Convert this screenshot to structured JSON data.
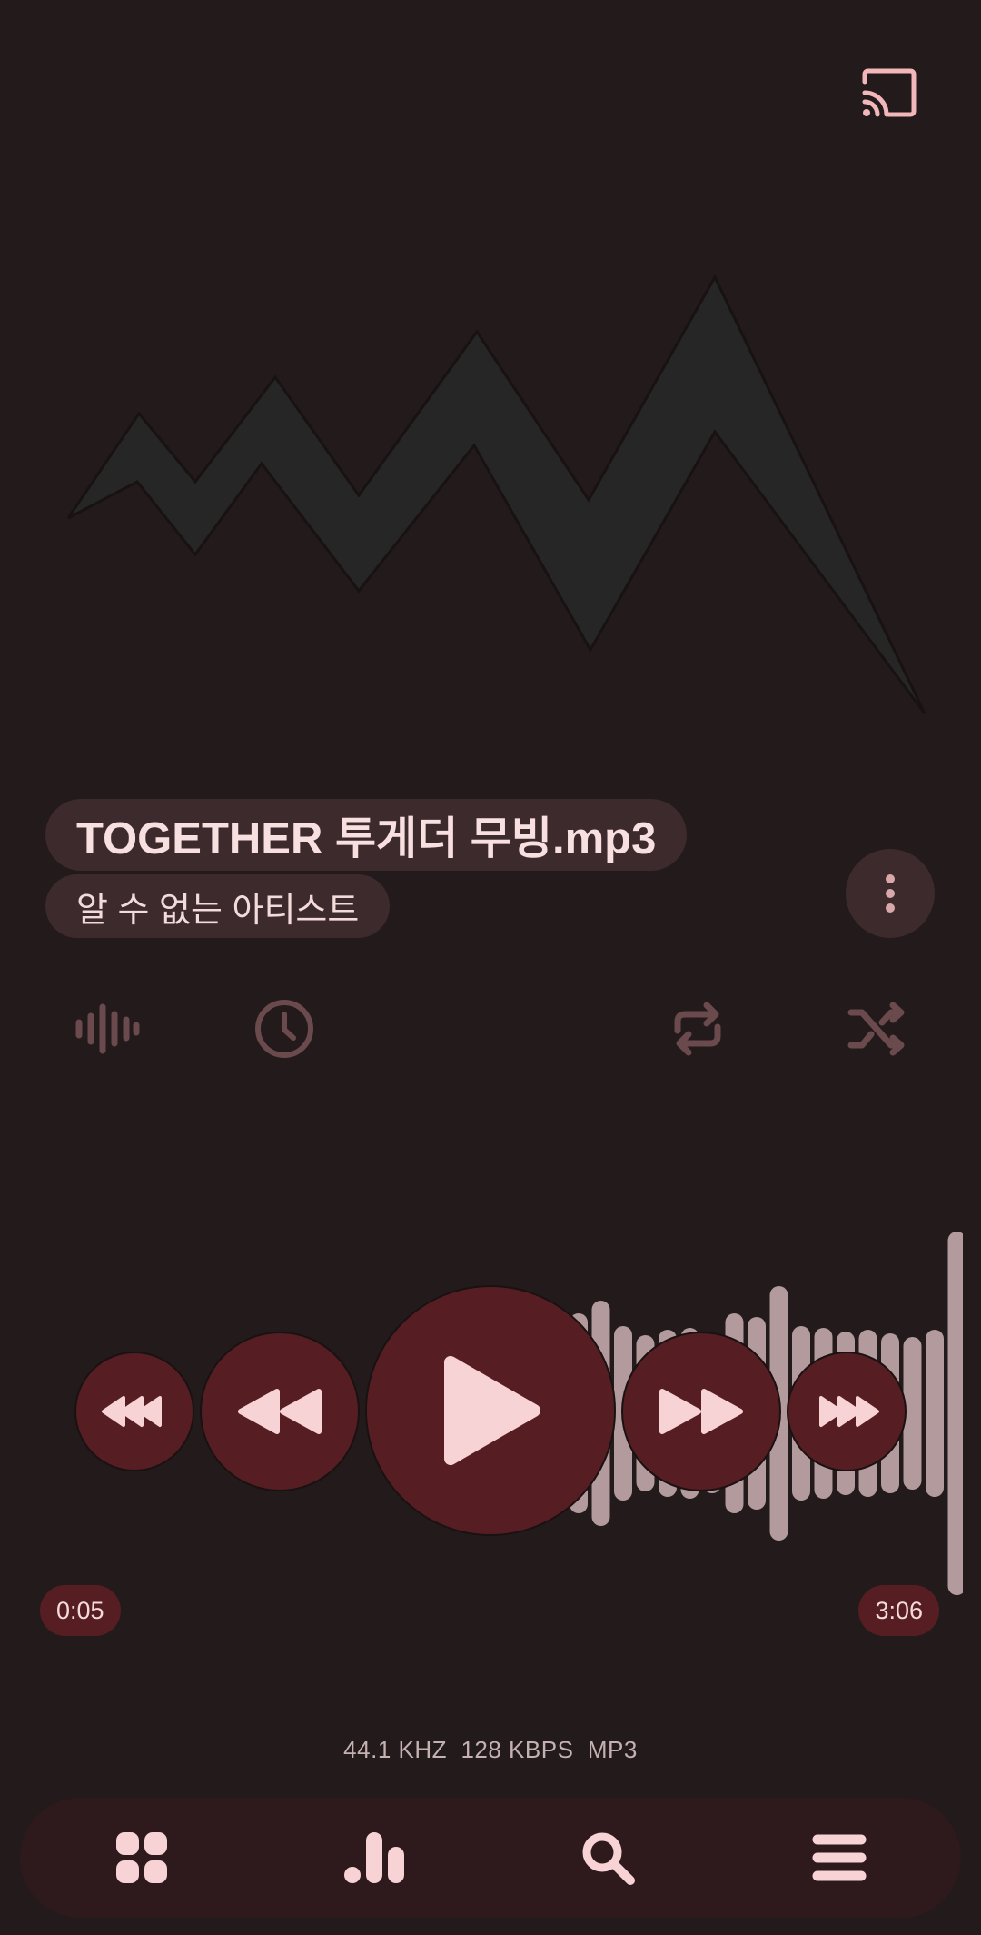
{
  "player": {
    "track_title": "TOGETHER 투게더 무빙.mp3",
    "artist": "알 수 없는 아티스트",
    "elapsed": "0:05",
    "duration": "3:06",
    "progress_fraction": 0.027,
    "format_info": "44.1 KHZ  128 KBPS  MP3"
  },
  "icons": {
    "cast": "cast-icon",
    "more": "more-vert-icon",
    "visualizer": "waveform-icon",
    "sleep_timer": "clock-icon",
    "repeat": "repeat-icon",
    "shuffle": "shuffle-icon",
    "skip_back_far": "fast-rewind-triple-icon",
    "rewind": "rewind-icon",
    "play": "play-icon",
    "fast_forward": "fast-forward-icon",
    "skip_forward_far": "fast-forward-triple-icon"
  },
  "nav": {
    "items": [
      "grid-icon",
      "chart-bars-icon",
      "search-icon",
      "menu-icon"
    ]
  },
  "colors": {
    "background": "#231a1b",
    "accent": "#561e22",
    "pill": "#3d2a2c",
    "text": "#f6d7d8"
  }
}
